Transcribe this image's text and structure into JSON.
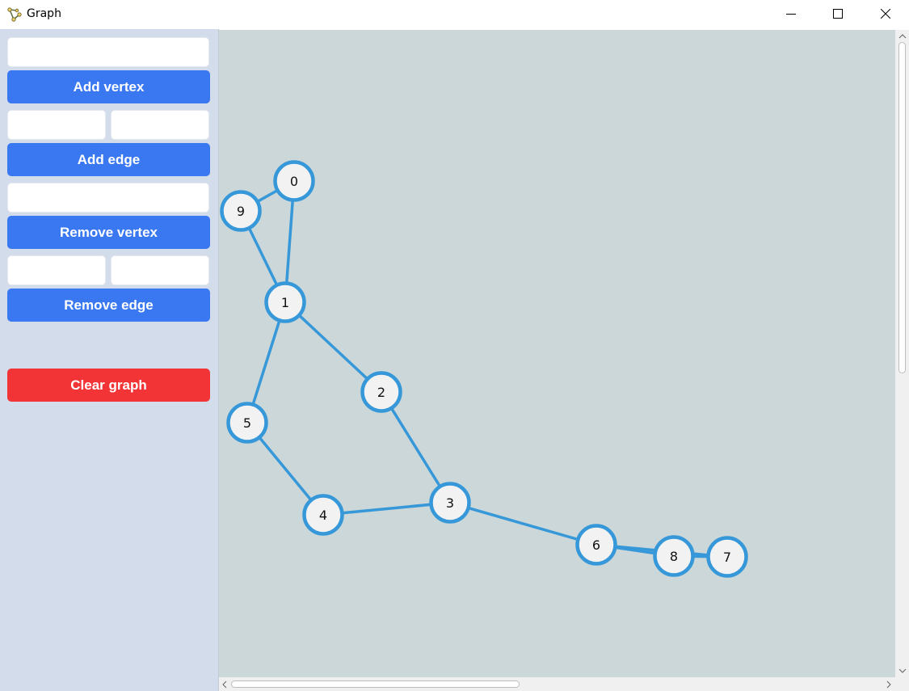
{
  "window": {
    "title": "Graph",
    "icons": {
      "app": "graph-app-icon",
      "minimize": "minimize-icon",
      "maximize": "maximize-icon",
      "close": "close-icon"
    }
  },
  "sidebar": {
    "vertex_input": {
      "value": "",
      "placeholder": ""
    },
    "add_vertex_label": "Add vertex",
    "edge_from_input": {
      "value": "",
      "placeholder": ""
    },
    "edge_to_input": {
      "value": "",
      "placeholder": ""
    },
    "add_edge_label": "Add edge",
    "remove_vertex_input": {
      "value": "",
      "placeholder": ""
    },
    "remove_vertex_label": "Remove vertex",
    "remove_edge_from_input": {
      "value": "",
      "placeholder": ""
    },
    "remove_edge_to_input": {
      "value": "",
      "placeholder": ""
    },
    "remove_edge_label": "Remove edge",
    "clear_graph_label": "Clear graph"
  },
  "colors": {
    "button_blue": "#3a78f2",
    "button_red": "#f33437",
    "sidebar_bg": "#d3dcea",
    "canvas_bg": "#cbd7d8",
    "vertex_stroke": "#3698d9",
    "vertex_fill": "#f2f2f2",
    "edge": "#3698d9"
  },
  "graph": {
    "vertices": [
      "0",
      "1",
      "2",
      "3",
      "4",
      "5",
      "6",
      "7",
      "8",
      "9"
    ],
    "edges": [
      [
        "0",
        "9"
      ],
      [
        "0",
        "1"
      ],
      [
        "9",
        "1"
      ],
      [
        "1",
        "2"
      ],
      [
        "1",
        "5"
      ],
      [
        "2",
        "3"
      ],
      [
        "5",
        "4"
      ],
      [
        "4",
        "3"
      ],
      [
        "3",
        "6"
      ],
      [
        "6",
        "8"
      ],
      [
        "6",
        "7"
      ],
      [
        "8",
        "7"
      ]
    ]
  }
}
